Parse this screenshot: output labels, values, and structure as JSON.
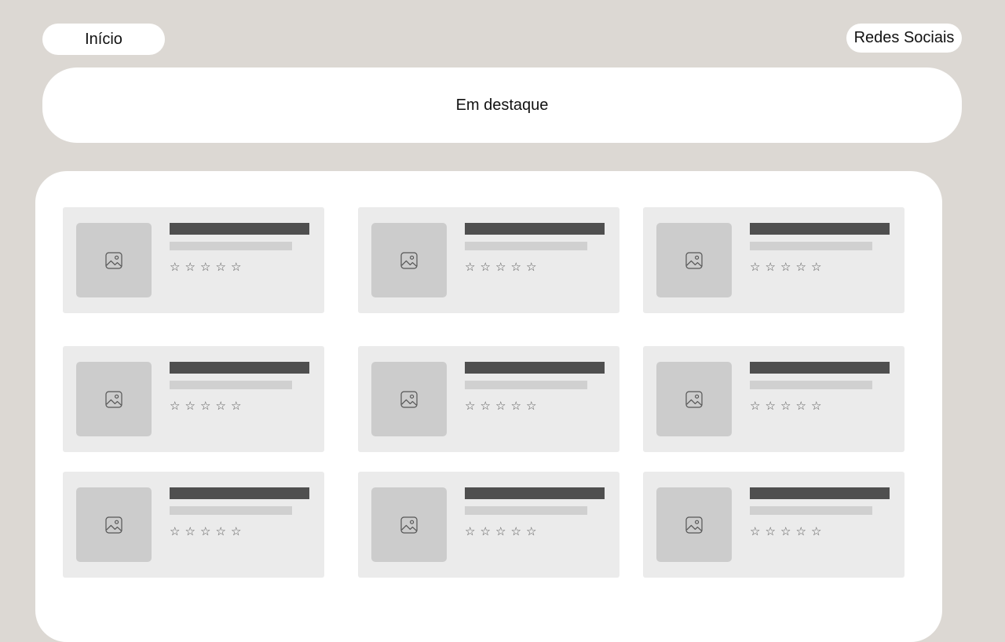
{
  "nav": {
    "home_label": "Início",
    "social_label": "Redes Sociais"
  },
  "featured": {
    "label": "Em destaque"
  },
  "grid": {
    "cards": [
      {
        "rating": 0,
        "max_rating": 5,
        "thumbnail_icon": "image-icon"
      },
      {
        "rating": 0,
        "max_rating": 5,
        "thumbnail_icon": "image-icon"
      },
      {
        "rating": 0,
        "max_rating": 5,
        "thumbnail_icon": "image-icon"
      },
      {
        "rating": 0,
        "max_rating": 5,
        "thumbnail_icon": "image-icon"
      },
      {
        "rating": 0,
        "max_rating": 5,
        "thumbnail_icon": "image-icon"
      },
      {
        "rating": 0,
        "max_rating": 5,
        "thumbnail_icon": "image-icon"
      },
      {
        "rating": 0,
        "max_rating": 5,
        "thumbnail_icon": "image-icon"
      },
      {
        "rating": 0,
        "max_rating": 5,
        "thumbnail_icon": "image-icon"
      },
      {
        "rating": 0,
        "max_rating": 5,
        "thumbnail_icon": "image-icon"
      }
    ]
  },
  "colors": {
    "background": "#dcd8d3",
    "surface": "#ffffff",
    "card": "#ebebeb",
    "thumbnail": "#cccccc",
    "title_placeholder": "#4f4f4f",
    "subtitle_placeholder": "#d0d0d0",
    "star": "#555555"
  }
}
